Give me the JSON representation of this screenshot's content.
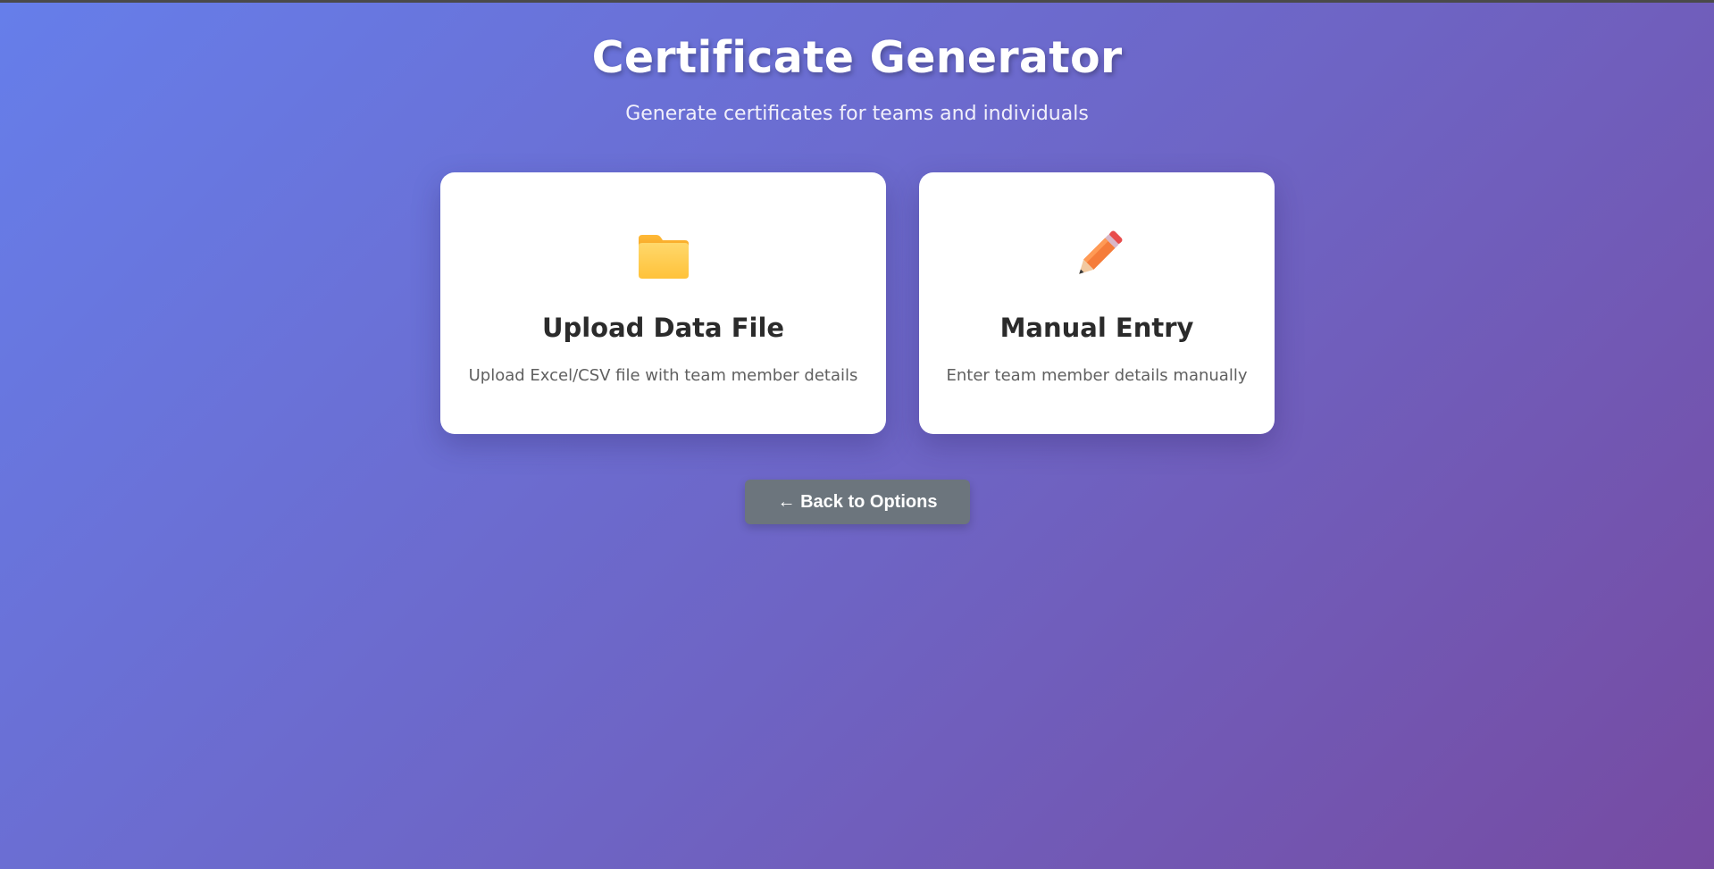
{
  "header": {
    "title": "Certificate Generator",
    "subtitle": "Generate certificates for teams and individuals"
  },
  "options": [
    {
      "icon": "folder-icon",
      "title": "Upload Data File",
      "description": "Upload Excel/CSV file with team member details"
    },
    {
      "icon": "pencil-icon",
      "title": "Manual Entry",
      "description": "Enter team member details manually"
    }
  ],
  "actions": {
    "back_label": "← Back to Options"
  },
  "colors": {
    "gradient_start": "#667eea",
    "gradient_end": "#764ba2",
    "card_background": "#ffffff",
    "back_button": "#6c757d",
    "folder": "#ffc83d",
    "pencil": "#f57c3a"
  }
}
